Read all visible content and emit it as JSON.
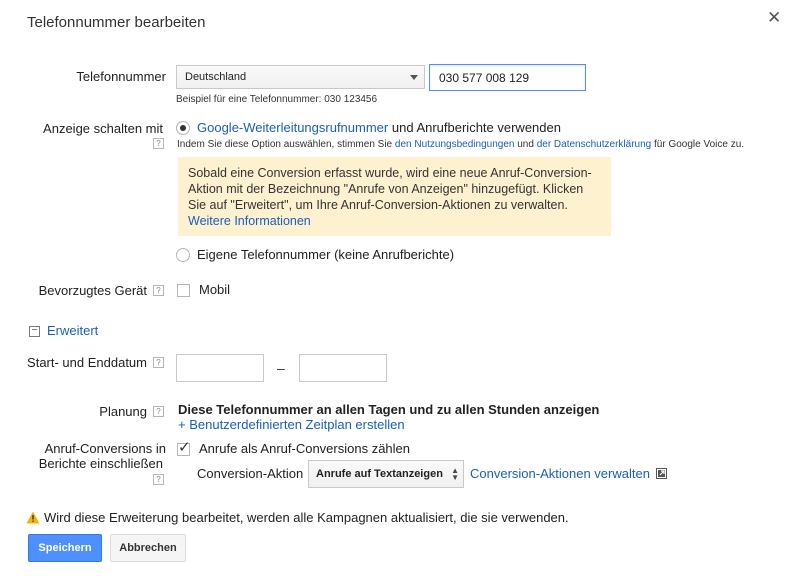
{
  "dialog": {
    "title": "Telefonnummer bearbeiten",
    "close_icon": "close-icon"
  },
  "phone": {
    "label": "Telefonnummer",
    "country_value": "Deutschland",
    "number_value": "030 577 008 129",
    "example": "Beispiel für eine Telefonnummer: 030 123456"
  },
  "display": {
    "label": "Anzeige schalten mit",
    "help": "?",
    "option_forwarding_link": "Google-Weiterleitungsrufnummer",
    "option_forwarding_rest": "und Anrufberichte verwenden",
    "terms_prefix": "Indem Sie diese Option auswählen, stimmen Sie",
    "terms_link": "den Nutzungsbedingungen",
    "terms_and": "und",
    "privacy_link": "der Datenschutzerklärung",
    "terms_suffix": "für Google Voice zu.",
    "notice_text": "Sobald eine Conversion erfasst wurde, wird eine neue Anruf-Conversion-Aktion mit der Bezeichnung \"Anrufe von Anzeigen\" hinzugefügt. Klicken Sie auf \"Erweitert\", um Ihre Anruf-Conversion-Aktionen zu verwalten.",
    "notice_link": "Weitere Informationen",
    "option_own": "Eigene Telefonnummer (keine Anrufberichte)"
  },
  "device": {
    "label": "Bevorzugtes Gerät",
    "help": "?",
    "option": "Mobil"
  },
  "advanced": {
    "toggle_symbol": "−",
    "label": "Erweitert"
  },
  "dates": {
    "label": "Start- und Enddatum",
    "help": "?",
    "separator": "–"
  },
  "schedule": {
    "label": "Planung",
    "help": "?",
    "text": "Diese Telefonnummer an allen Tagen und zu allen Stunden anzeigen",
    "link": "+ Benutzerdefinierten Zeitplan erstellen"
  },
  "conversions": {
    "label_line1": "Anruf-Conversions in",
    "label_line2": "Berichte einschließen",
    "help": "?",
    "checkbox_label": "Anrufe als Anruf-Conversions zählen",
    "action_label": "Conversion-Aktion",
    "action_value": "Anrufe auf Textanzeigen",
    "manage_link": "Conversion-Aktionen verwalten",
    "external_icon": "external-link-icon"
  },
  "warning": {
    "icon": "warning-icon",
    "text": "Wird diese Erweiterung bearbeitet, werden alle Kampagnen aktualisiert, die sie verwenden."
  },
  "buttons": {
    "save": "Speichern",
    "cancel": "Abbrechen"
  },
  "colors": {
    "primary": "#4d90fe",
    "link": "#1a5ebe",
    "notice_bg": "#fdf1d0",
    "warning": "#f4b400"
  }
}
